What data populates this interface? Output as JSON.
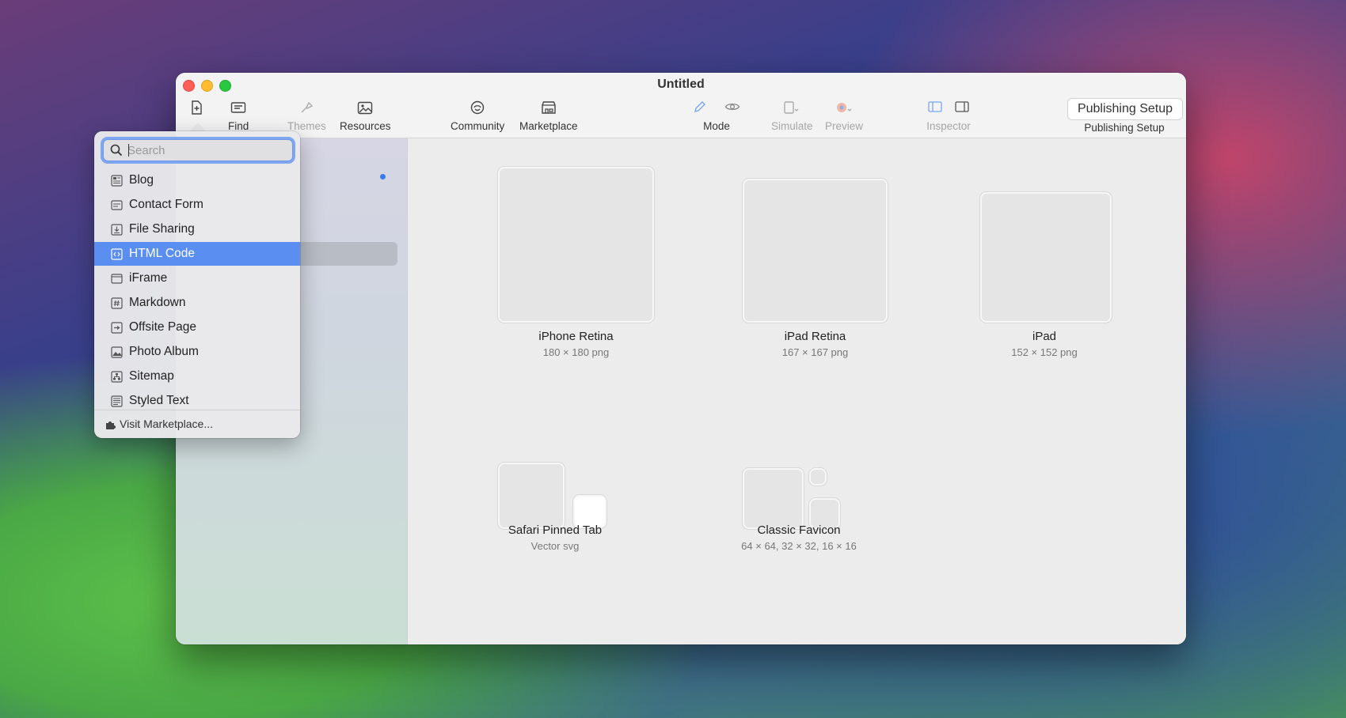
{
  "window": {
    "title": "Untitled"
  },
  "toolbar": {
    "find": "Find",
    "themes": "Themes",
    "resources": "Resources",
    "community": "Community",
    "marketplace": "Marketplace",
    "mode": "Mode",
    "simulate": "Simulate",
    "preview": "Preview",
    "inspector": "Inspector",
    "publishing_button": "Publishing Setup",
    "publishing_label": "Publishing Setup"
  },
  "icons": [
    {
      "name": "iPhone Retina",
      "detail": "180 × 180 png"
    },
    {
      "name": "iPad Retina",
      "detail": "167 × 167 png"
    },
    {
      "name": "iPad",
      "detail": "152 × 152 png"
    },
    {
      "name": "Safari Pinned Tab",
      "detail": "Vector svg"
    },
    {
      "name": "Classic Favicon",
      "detail": "64 × 64, 32 × 32, 16 × 16"
    }
  ],
  "popup": {
    "search_placeholder": "Search",
    "items": [
      {
        "label": "Blog",
        "icon": "blog-icon"
      },
      {
        "label": "Contact Form",
        "icon": "contact-form-icon"
      },
      {
        "label": "File Sharing",
        "icon": "file-sharing-icon"
      },
      {
        "label": "HTML Code",
        "icon": "html-code-icon",
        "selected": true
      },
      {
        "label": "iFrame",
        "icon": "iframe-icon"
      },
      {
        "label": "Markdown",
        "icon": "markdown-icon"
      },
      {
        "label": "Offsite Page",
        "icon": "offsite-page-icon"
      },
      {
        "label": "Photo Album",
        "icon": "photo-album-icon"
      },
      {
        "label": "Sitemap",
        "icon": "sitemap-icon"
      },
      {
        "label": "Styled Text",
        "icon": "styled-text-icon"
      }
    ],
    "visit_marketplace": "Visit Marketplace..."
  },
  "colors": {
    "accent": "#5a8ef0",
    "close": "#ff5f57",
    "minimize": "#febc2e",
    "zoom": "#28c840"
  }
}
